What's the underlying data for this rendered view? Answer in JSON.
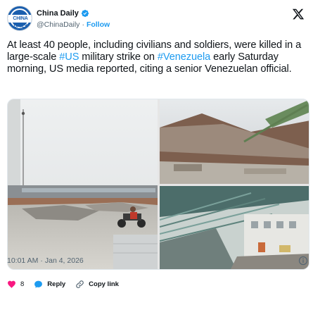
{
  "account": {
    "display_name": "China Daily",
    "handle": "@ChinaDaily",
    "separator": "·",
    "follow_label": "Follow",
    "avatar_text": "CHINA DAILY",
    "verified_color": "#1d9bf0"
  },
  "tweet": {
    "text_parts": [
      {
        "text": "At least 40 people, including civilians and soldiers, were killed in a large-scale ",
        "type": "text"
      },
      {
        "text": "#US",
        "type": "hashtag"
      },
      {
        "text": " military strike on ",
        "type": "text"
      },
      {
        "text": "#Venezuela",
        "type": "hashtag"
      },
      {
        "text": " early Saturday morning, US media reported, citing a senior Venezuelan official.",
        "type": "text"
      }
    ],
    "media_count": 3
  },
  "meta": {
    "time": "10:01 AM",
    "separator": "·",
    "date": "Jan 4, 2026"
  },
  "actions": {
    "like_count": "8",
    "reply_label": "Reply",
    "copy_link_label": "Copy link"
  },
  "colors": {
    "accent": "#1d9bf0",
    "like": "#f91880",
    "text": "#0f1419",
    "muted": "#536471"
  },
  "icons": {
    "brand": "x-logo-icon",
    "verified": "verified-badge-icon",
    "info": "info-icon",
    "like": "heart-icon",
    "reply": "reply-bubble-icon",
    "copy": "link-icon"
  }
}
